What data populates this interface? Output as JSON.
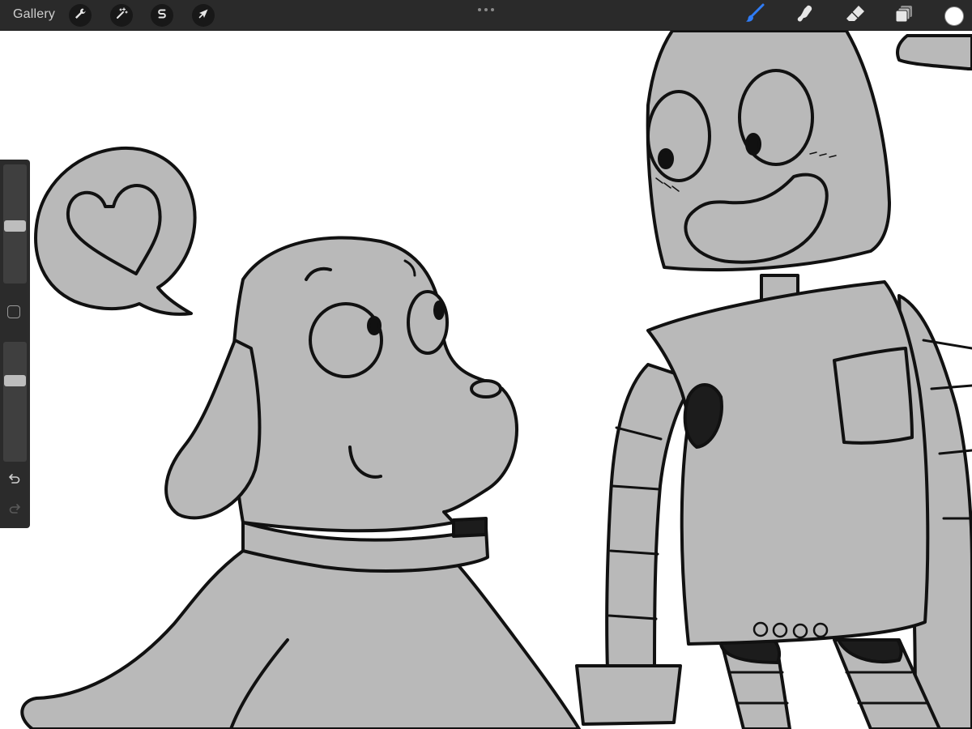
{
  "topbar": {
    "gallery_label": "Gallery",
    "left_tools": [
      "wrench-actions",
      "magic-wand-adjustments",
      "s-selection",
      "arrow-transform"
    ],
    "right_tools": [
      "brush",
      "smudge",
      "eraser",
      "layers"
    ],
    "active_tool": "brush",
    "accent_color": "#2f7cf6",
    "current_color": "#ffffff"
  },
  "sidebar": {
    "brush_size_level": 0.48,
    "opacity_level": 0.7,
    "icons": [
      "modifier-square",
      "undo",
      "redo"
    ]
  },
  "artwork": {
    "characters": [
      "dog",
      "robot"
    ],
    "speech_bubble_icon": "heart",
    "fill_color": "#b9b9b9",
    "line_color": "#111111"
  }
}
